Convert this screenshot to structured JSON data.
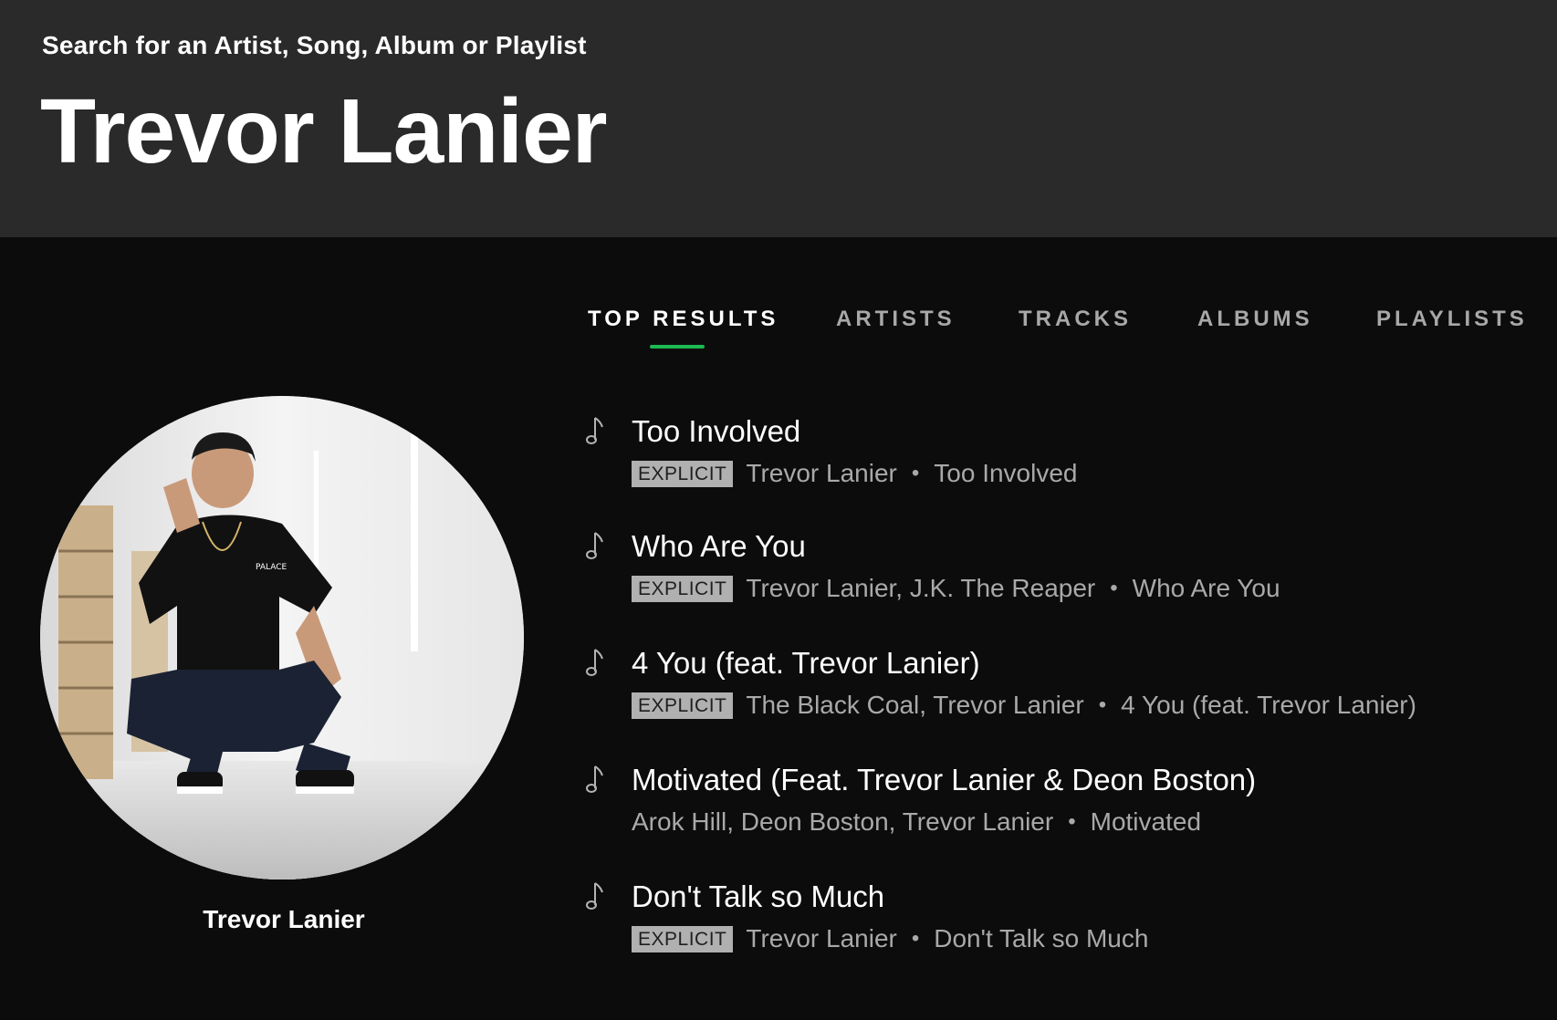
{
  "header": {
    "search_label": "Search for an Artist, Song, Album or Playlist",
    "query": "Trevor Lanier"
  },
  "tabs": [
    {
      "label": "TOP RESULTS",
      "active": true
    },
    {
      "label": "ARTISTS",
      "active": false
    },
    {
      "label": "TRACKS",
      "active": false
    },
    {
      "label": "ALBUMS",
      "active": false
    },
    {
      "label": "PLAYLISTS",
      "active": false
    }
  ],
  "accent_color": "#1db954",
  "artist": {
    "name": "Trevor Lanier",
    "shirt_text": "PALACE"
  },
  "tracks": [
    {
      "title": "Too Involved",
      "explicit": "EXPLICIT",
      "artists": "Trevor Lanier",
      "album": "Too Involved"
    },
    {
      "title": "Who Are You",
      "explicit": "EXPLICIT",
      "artists": "Trevor Lanier, J.K. The Reaper",
      "album": "Who Are You"
    },
    {
      "title": "4 You (feat. Trevor Lanier)",
      "explicit": "EXPLICIT",
      "artists": "The Black Coal, Trevor Lanier",
      "album": "4 You (feat. Trevor Lanier)"
    },
    {
      "title": "Motivated (Feat. Trevor Lanier & Deon Boston)",
      "explicit": "",
      "artists": "Arok Hill, Deon Boston, Trevor Lanier",
      "album": "Motivated"
    },
    {
      "title": "Don't Talk so Much",
      "explicit": "EXPLICIT",
      "artists": "Trevor Lanier",
      "album": "Don't Talk so Much"
    }
  ],
  "separator": "•",
  "icons": {
    "track": "music-note-icon"
  }
}
